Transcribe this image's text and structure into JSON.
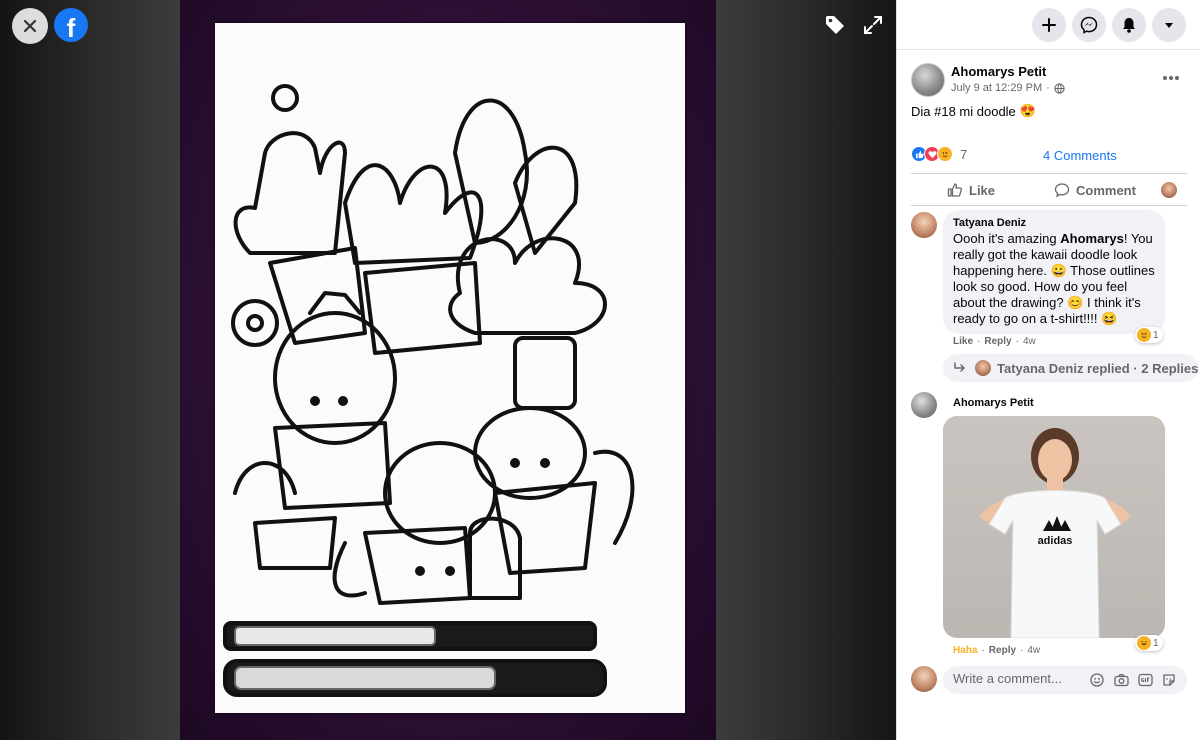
{
  "viewer": {
    "logo": "f"
  },
  "post": {
    "author": "Ahomarys Petit",
    "date": "July 9 at 12:29 PM",
    "audience_sep": "·",
    "caption": "Dia #18 mi doodle",
    "caption_emoji": "😍",
    "reaction_count": "7",
    "comments_link": "4 Comments",
    "like_label": "Like",
    "comment_label": "Comment"
  },
  "comments": [
    {
      "name": "Tatyana Deniz",
      "text_before": "Oooh it's amazing ",
      "text_bold": "Ahomarys",
      "text_after": "! You really got the kawaii doodle look happening here. 😀 Those outlines look so good. How do you feel about the drawing? 😊 I think it's ready to go on a t-shirt!!!! 😆",
      "reaction_count": "1",
      "like": "Like",
      "reply": "Reply",
      "age": "4w",
      "sep": "·"
    },
    {
      "name": "Ahomarys Petit",
      "reaction_count": "1",
      "haha": "Haha",
      "reply": "Reply",
      "age": "4w",
      "sep": "·",
      "image_brand": "adidas"
    }
  ],
  "replies": {
    "label": "Tatyana Deniz replied · 2 Replies"
  },
  "composer": {
    "placeholder": "Write a comment..."
  },
  "icons": [
    "close-icon",
    "facebook-logo",
    "tag-icon",
    "expand-icon",
    "plus-icon",
    "messenger-icon",
    "bell-icon",
    "caret-down-icon",
    "more-icon",
    "globe-icon",
    "like-icon",
    "comment-icon",
    "reply-arrow-icon",
    "emoji-icon",
    "camera-icon",
    "gif-icon",
    "sticker-icon"
  ],
  "colors": {
    "accent": "#1877f2",
    "haha": "#f7b125",
    "love": "#f33e58"
  }
}
